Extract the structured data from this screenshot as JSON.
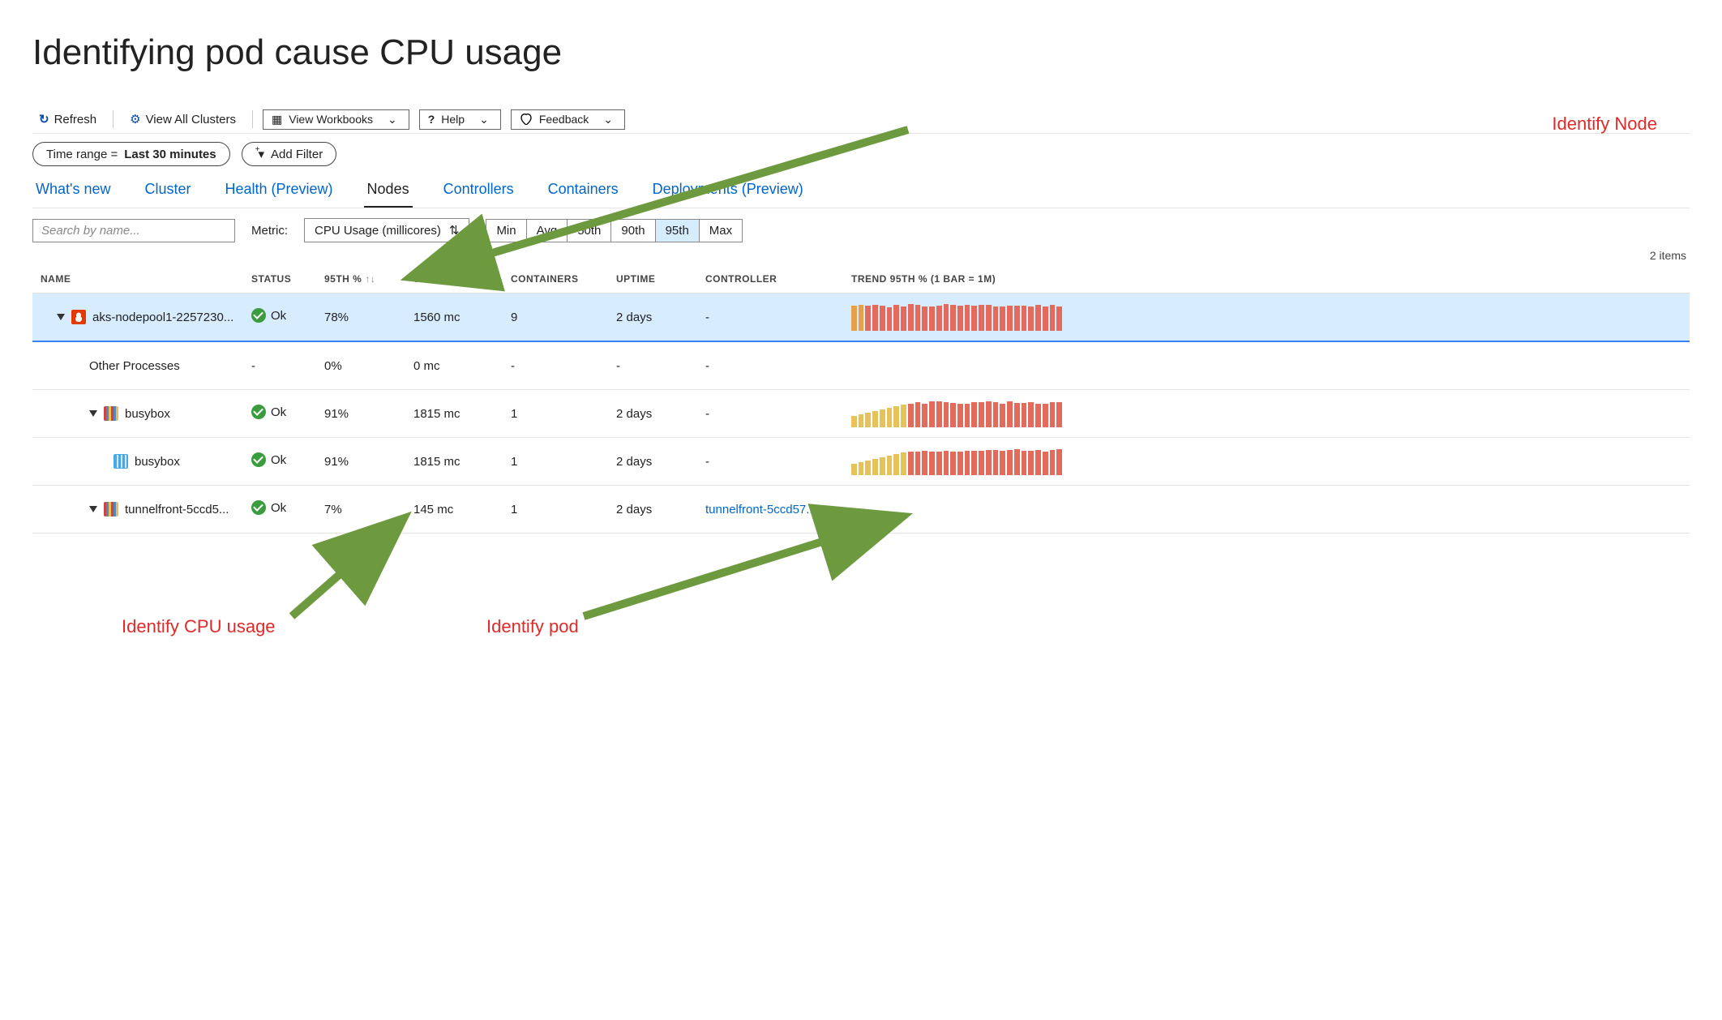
{
  "title": "Identifying pod cause CPU usage",
  "toolbar": {
    "refresh": "Refresh",
    "view_all_clusters": "View All Clusters",
    "view_workbooks": "View Workbooks",
    "help": "Help",
    "feedback": "Feedback"
  },
  "pills": {
    "time_range_label": "Time range = ",
    "time_range_value": "Last 30 minutes",
    "add_filter": "Add Filter"
  },
  "tabs": [
    {
      "label": "What's new",
      "active": false
    },
    {
      "label": "Cluster",
      "active": false
    },
    {
      "label": "Health (Preview)",
      "active": false
    },
    {
      "label": "Nodes",
      "active": true
    },
    {
      "label": "Controllers",
      "active": false
    },
    {
      "label": "Containers",
      "active": false
    },
    {
      "label": "Deployments (Preview)",
      "active": false
    }
  ],
  "filters": {
    "search_placeholder": "Search by name...",
    "metric_label": "Metric:",
    "metric_value": "CPU Usage (millicores)",
    "seg": [
      "Min",
      "Avg",
      "50th",
      "90th",
      "95th",
      "Max"
    ],
    "seg_active": "95th"
  },
  "items_count": "2 items",
  "columns": {
    "name": "NAME",
    "status": "STATUS",
    "p95pct": "95TH %",
    "p95": "95TH",
    "containers": "CONTAINERS",
    "uptime": "UPTIME",
    "controller": "CONTROLLER",
    "trend": "TREND 95TH % (1 BAR = 1M)"
  },
  "rows": [
    {
      "indent": 0,
      "icon": "linux",
      "highlight": true,
      "name": "aks-nodepool1-2257230...",
      "status": "Ok",
      "p95pct": "78%",
      "p95": "1560 mc",
      "containers": "9",
      "uptime": "2 days",
      "controller": "-",
      "trend_pattern": "high"
    },
    {
      "indent": 1,
      "icon": "none",
      "name": "Other Processes",
      "status": "-",
      "p95pct": "0%",
      "p95": "0 mc",
      "containers": "-",
      "uptime": "-",
      "controller": "-",
      "trend_pattern": "none"
    },
    {
      "indent": 1,
      "icon": "pod",
      "name": "busybox",
      "status": "Ok",
      "p95pct": "91%",
      "p95": "1815 mc",
      "containers": "1",
      "uptime": "2 days",
      "controller": "-",
      "trend_pattern": "ramp"
    },
    {
      "indent": 2,
      "icon": "container",
      "no_caret": true,
      "name": "busybox",
      "status": "Ok",
      "p95pct": "91%",
      "p95": "1815 mc",
      "containers": "1",
      "uptime": "2 days",
      "controller": "-",
      "trend_pattern": "ramp"
    },
    {
      "indent": 1,
      "icon": "pod",
      "name": "tunnelfront-5ccd5...",
      "status": "Ok",
      "p95pct": "7%",
      "p95": "145 mc",
      "containers": "1",
      "uptime": "2 days",
      "controller": "tunnelfront-5ccd57...",
      "controller_link": true,
      "trend_pattern": "none"
    }
  ],
  "annotations": {
    "identify_node": "Identify Node",
    "identify_cpu": "Identify CPU usage",
    "identify_pod": "Identify pod"
  }
}
